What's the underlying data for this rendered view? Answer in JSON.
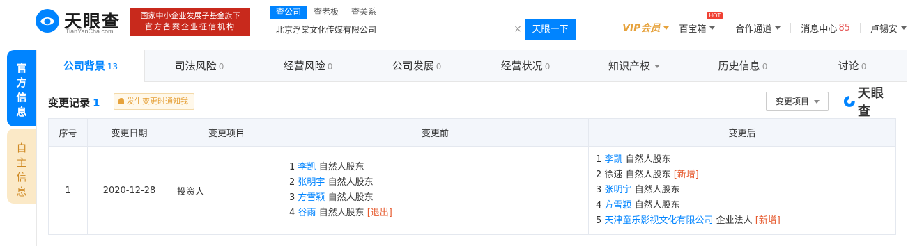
{
  "header": {
    "logo_name": "天眼查",
    "logo_url": "TianYanCha.com",
    "banner_line1": "国家中小企业发展子基金旗下",
    "banner_line2": "官方备案企业征信机构",
    "search_tabs": [
      "查公司",
      "查老板",
      "查关系"
    ],
    "search_value": "北京浮棠文化传媒有限公司",
    "search_button": "天眼一下",
    "nav": {
      "vip": "VIP会员",
      "baibao": "百宝箱",
      "hot": "HOT",
      "partner": "合作通道",
      "messages": "消息中心",
      "message_count": "85",
      "user": "卢锡安"
    }
  },
  "side": {
    "official": "官方信息",
    "self": "自主信息"
  },
  "tabs": [
    {
      "label": "公司背景",
      "count": "13"
    },
    {
      "label": "司法风险",
      "count": "0"
    },
    {
      "label": "经营风险",
      "count": "0"
    },
    {
      "label": "公司发展",
      "count": "0"
    },
    {
      "label": "经营状况",
      "count": "0"
    },
    {
      "label": "知识产权",
      "count": ""
    },
    {
      "label": "历史信息",
      "count": "0"
    },
    {
      "label": "讨论",
      "count": "0"
    }
  ],
  "section": {
    "title": "变更记录",
    "count": "1",
    "notify": "发生变更时通知我",
    "filter": "变更项目",
    "watermark": "天眼查"
  },
  "table": {
    "headers": [
      "序号",
      "变更日期",
      "变更项目",
      "变更前",
      "变更后"
    ],
    "row": {
      "index": "1",
      "date": "2020-12-28",
      "item": "投资人",
      "before": [
        {
          "n": "1",
          "name": "李凯",
          "role": "自然人股东",
          "tag": ""
        },
        {
          "n": "2",
          "name": "张明宇",
          "role": "自然人股东",
          "tag": ""
        },
        {
          "n": "3",
          "name": "方雪颖",
          "role": "自然人股东",
          "tag": ""
        },
        {
          "n": "4",
          "name": "谷雨",
          "role": "自然人股东",
          "tag": "[退出]"
        }
      ],
      "after": [
        {
          "n": "1",
          "name": "李凯",
          "role": "自然人股东",
          "tag": ""
        },
        {
          "n": "2",
          "name": "徐速",
          "role": "自然人股东",
          "tag": "[新增]"
        },
        {
          "n": "3",
          "name": "张明宇",
          "role": "自然人股东",
          "tag": ""
        },
        {
          "n": "4",
          "name": "方雪颖",
          "role": "自然人股东",
          "tag": ""
        },
        {
          "n": "5",
          "name": "天津童乐影视文化有限公司",
          "role": "企业法人",
          "tag": "[新增]"
        }
      ]
    }
  }
}
